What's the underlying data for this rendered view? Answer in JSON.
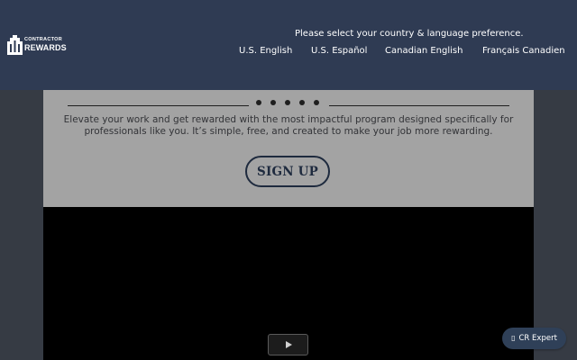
{
  "header": {
    "logo": {
      "line1": "CONTRACTOR",
      "line2": "REWARDS"
    },
    "prompt": "Please select your country & language preference.",
    "languages": [
      {
        "label": "U.S. English"
      },
      {
        "label": "U.S. Español"
      },
      {
        "label": "Canadian English"
      },
      {
        "label": "Français Canadien"
      }
    ]
  },
  "main": {
    "intro": "Elevate your work and get rewarded with the most impactful program designed specifically for professionals like you. It’s simple, free, and created to make your job more rewarding.",
    "signup_label": "SIGN UP"
  },
  "video": {
    "play_icon": "play-icon"
  },
  "chat": {
    "icon": "chat-icon",
    "label": "CR Expert"
  },
  "colors": {
    "header_bg": "#2f3b53",
    "page_bg": "#363b44",
    "card_bg": "#a3a3a3",
    "button_border": "#1e2a3e",
    "chat_bg": "#2f4058"
  }
}
